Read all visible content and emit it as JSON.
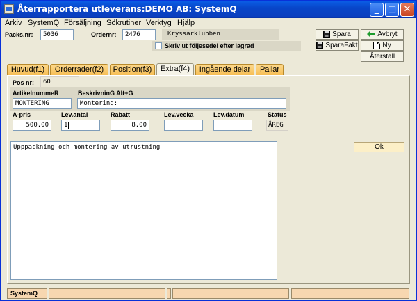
{
  "window": {
    "title": "Återrapportera utleverans:DEMO AB: SystemQ",
    "controls": {
      "minimize": "_",
      "maximize": "□",
      "close": "✕"
    }
  },
  "menu": [
    "Arkiv",
    "SystemQ",
    "Försäljning",
    "Sökrutiner",
    "Verktyg",
    "Hjälp"
  ],
  "header": {
    "packs_label": "Packs.nr:",
    "packs_value": "5036",
    "order_label": "Ordernr:",
    "order_value": "2476",
    "customer_name": "Kryssarklubben",
    "print_checkbox_label": "Skriv ut följesedel efter lagrad",
    "print_checkbox_checked": false
  },
  "toolbar": {
    "spara": "Spara",
    "avbryt": "Avbryt",
    "sparafakt": "SparaFakt",
    "ny": "Ny",
    "aterstall": "Återställ"
  },
  "tabs": [
    {
      "label": "Huvud(f1)",
      "active": false
    },
    {
      "label": "Orderrader(f2)",
      "active": false
    },
    {
      "label": "Position(f3)",
      "active": false
    },
    {
      "label": "Extra(f4)",
      "active": true
    },
    {
      "label": "Ingående delar",
      "active": false
    },
    {
      "label": "Pallar",
      "active": false
    }
  ],
  "row": {
    "posnr_label": "Pos nr:",
    "posnr_value": "60",
    "artikel_label": "ArtikelnummeR",
    "artikel_value": "MONTERING",
    "beskrivning_label": "BeskrivninG Alt+G",
    "beskrivning_value": "Montering:",
    "apris_label": "A-pris",
    "apris_value": "500.00",
    "levantal_label": "Lev.antal",
    "levantal_value": "1",
    "rabatt_label": "Rabatt",
    "rabatt_value": "8.00",
    "levvecka_label": "Lev.vecka",
    "levvecka_value": "",
    "levdatum_label": "Lev.datum",
    "levdatum_value": "",
    "status_label": "Status",
    "status_value": "ÅREG"
  },
  "notes_text": "Upppackning och montering av utrustning",
  "ok_button": "Ok",
  "statusbar": [
    "SystemQ",
    "",
    "",
    "",
    ""
  ],
  "colors": {
    "titlebar": "#0A50D8",
    "tab": "#F6BE55",
    "statusbar": "#F7D7B0"
  }
}
